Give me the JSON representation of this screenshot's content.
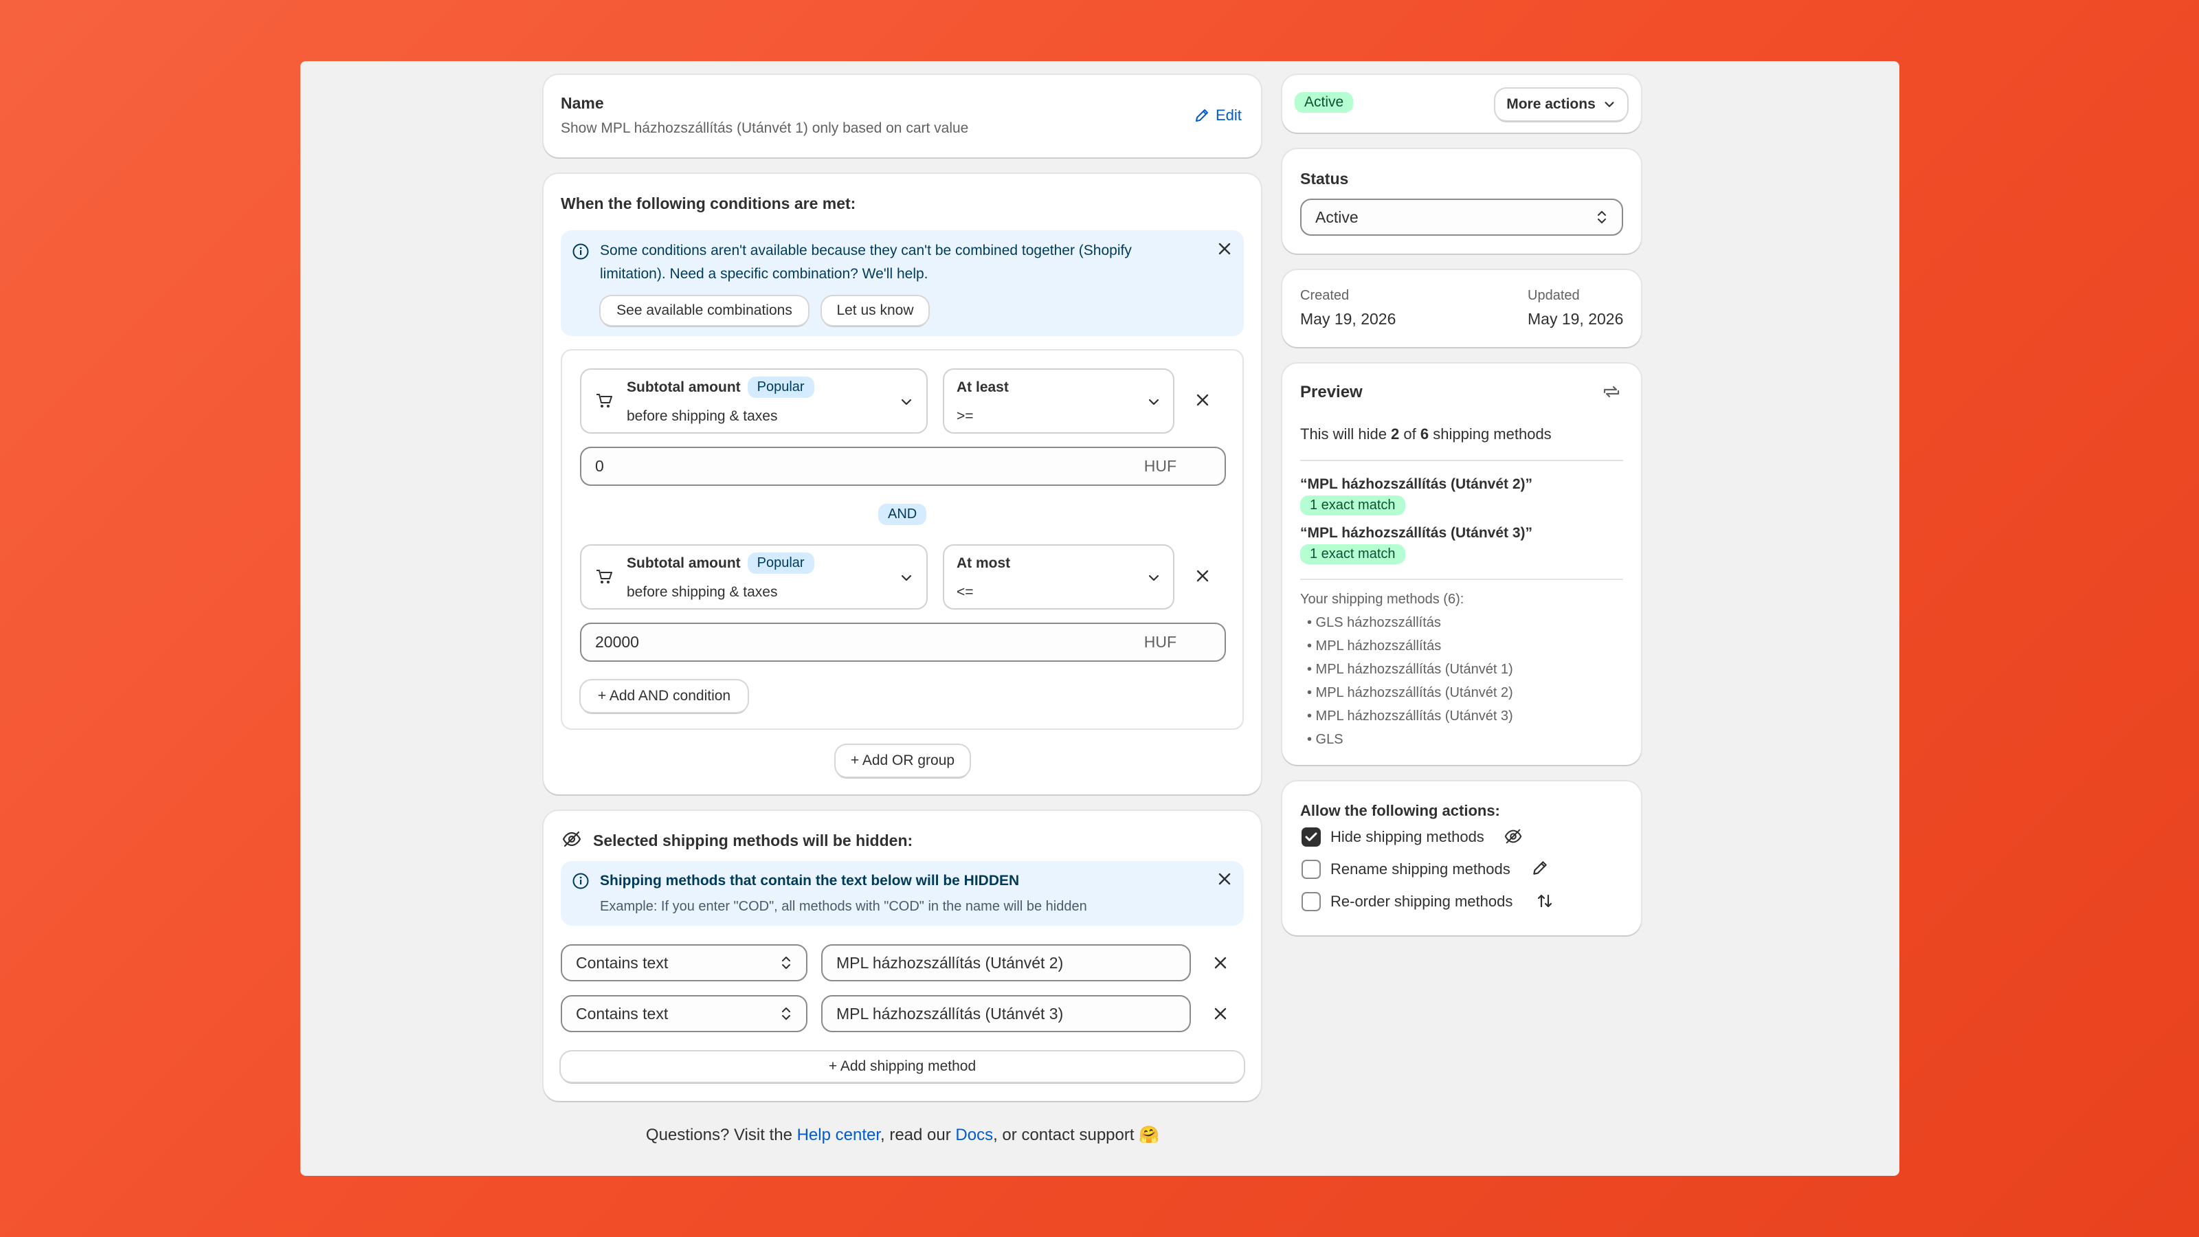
{
  "name_card": {
    "label": "Name",
    "value": "Show MPL házhozszállítás (Utánvét 1) only based on cart value",
    "edit": "Edit"
  },
  "conditions": {
    "heading": "When the following conditions are met:",
    "banner_text_line1": "Some conditions aren't available because they can't be combined together (Shopify",
    "banner_text_line2": "limitation). Need a specific combination? We'll help.",
    "see_combinations": "See available combinations",
    "let_us_know": "Let us know",
    "rows": [
      {
        "title": "Subtotal amount",
        "badge": "Popular",
        "subtitle": "before shipping & taxes",
        "op_title": "At least",
        "op_sub": ">=",
        "value": "0",
        "unit": "HUF"
      },
      {
        "title": "Subtotal amount",
        "badge": "Popular",
        "subtitle": "before shipping & taxes",
        "op_title": "At most",
        "op_sub": "<=",
        "value": "20000",
        "unit": "HUF"
      }
    ],
    "and_label": "AND",
    "add_and": "+ Add AND condition",
    "add_or": "+ Add OR group"
  },
  "hidden": {
    "heading": "Selected shipping methods will be hidden:",
    "banner_title": "Shipping methods that contain the text below will be HIDDEN",
    "banner_example": "Example: If you enter \"COD\", all methods with \"COD\" in the name will be hidden",
    "rows": [
      {
        "match": "Contains text",
        "text": "MPL házhozszállítás (Utánvét 2)"
      },
      {
        "match": "Contains text",
        "text": "MPL házhozszállítás (Utánvét 3)"
      }
    ],
    "add_method": "+ Add shipping method"
  },
  "footer": {
    "prefix": "Questions? Visit the ",
    "help": "Help center",
    "mid": ", read our ",
    "docs": "Docs",
    "suffix": ", or contact support 🤗"
  },
  "sidebar": {
    "status_badge": "Active",
    "more_actions": "More actions",
    "status_label": "Status",
    "status_value": "Active",
    "created_label": "Created",
    "created_value": "May 19, 2026",
    "updated_label": "Updated",
    "updated_value": "May 19, 2026",
    "preview_title": "Preview",
    "preview_pre": "This will hide ",
    "preview_count": "2",
    "preview_mid": " of ",
    "preview_total": "6",
    "preview_post": " shipping methods",
    "matches": [
      {
        "name": "“MPL házhozszállítás (Utánvét 2)”",
        "badge": "1 exact match"
      },
      {
        "name": "“MPL házhozszállítás (Utánvét 3)”",
        "badge": "1 exact match"
      }
    ],
    "methods_label": "Your shipping methods (6):",
    "methods": [
      "• GLS házhozszállítás",
      "• MPL házhozszállítás",
      "• MPL házhozszállítás (Utánvét 1)",
      "• MPL házhozszállítás (Utánvét 2)",
      "• MPL házhozszállítás (Utánvét 3)",
      "• GLS"
    ],
    "actions_label": "Allow the following actions:",
    "actions": [
      {
        "label": "Hide shipping methods",
        "checked": true
      },
      {
        "label": "Rename shipping methods",
        "checked": false
      },
      {
        "label": "Re-order shipping methods",
        "checked": false
      }
    ]
  }
}
